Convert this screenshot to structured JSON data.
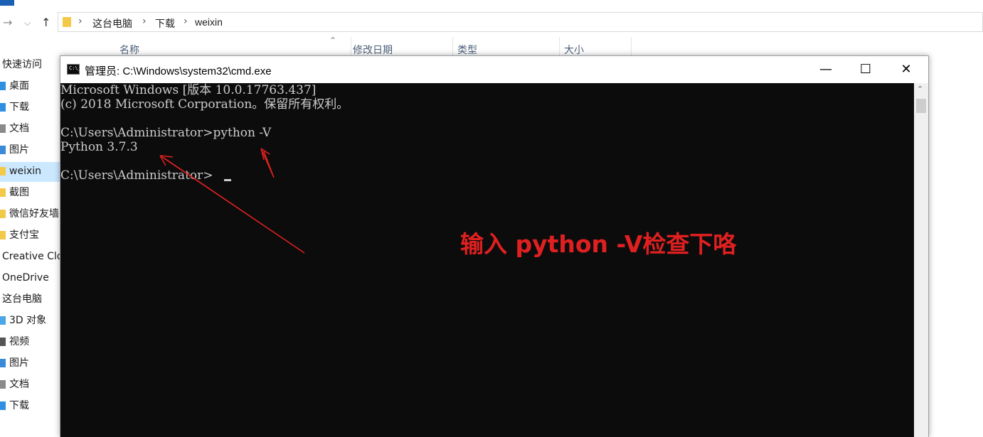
{
  "explorer": {
    "breadcrumb": [
      "这台电脑",
      "下载",
      "weixin"
    ],
    "columns": [
      "名称",
      "修改日期",
      "类型",
      "大小"
    ],
    "sidebar": [
      {
        "label": "快速访问",
        "icon": "star-icon",
        "head": true
      },
      {
        "label": "桌面",
        "icon": "desktop-icon"
      },
      {
        "label": "下载",
        "icon": "download-icon"
      },
      {
        "label": "文档",
        "icon": "document-icon"
      },
      {
        "label": "图片",
        "icon": "picture-icon"
      },
      {
        "label": "weixin",
        "icon": "folder-icon",
        "selected": true
      },
      {
        "label": "截图",
        "icon": "folder-icon"
      },
      {
        "label": "微信好友墙",
        "icon": "folder-icon"
      },
      {
        "label": "支付宝",
        "icon": "folder-icon"
      },
      {
        "label": "Creative Clo",
        "icon": "cloud-icon",
        "head": true
      },
      {
        "label": "OneDrive",
        "icon": "onedrive-icon",
        "head": true
      },
      {
        "label": "这台电脑",
        "icon": "pc-icon",
        "head": true
      },
      {
        "label": "3D 对象",
        "icon": "3d-icon"
      },
      {
        "label": "视频",
        "icon": "video-icon"
      },
      {
        "label": "图片",
        "icon": "picture-icon"
      },
      {
        "label": "文档",
        "icon": "document-icon"
      },
      {
        "label": "下载",
        "icon": "download-icon"
      }
    ]
  },
  "cmd": {
    "title": "管理员: C:\\Windows\\system32\\cmd.exe",
    "icon_text": "C:\\_",
    "buttons": {
      "minimize": "—",
      "maximize": "☐",
      "close": "✕"
    },
    "lines": [
      "Microsoft Windows [版本 10.0.17763.437]",
      "(c) 2018 Microsoft Corporation。保留所有权利。",
      "",
      "C:\\Users\\Administrator>python -V",
      "Python 3.7.3",
      "",
      "C:\\Users\\Administrator>"
    ],
    "annotation": "输入 python -V检查下咯"
  },
  "colors": {
    "console_bg": "#0c0c0c",
    "console_text": "#cccccc",
    "annotation": "#e02020",
    "selection": "#cce8ff"
  }
}
